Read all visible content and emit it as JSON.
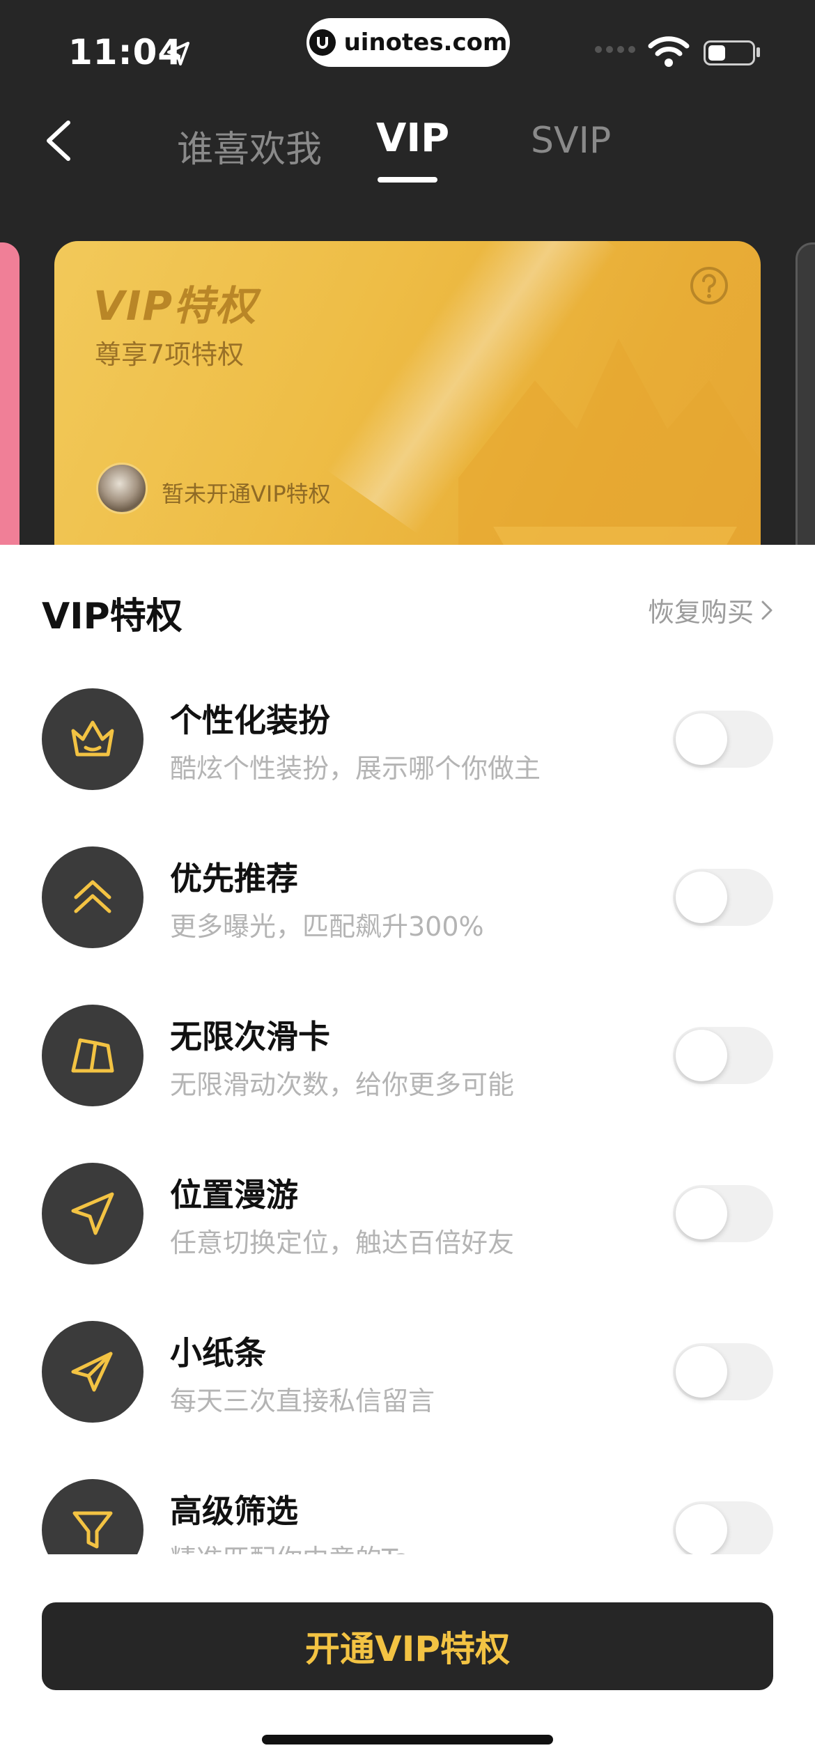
{
  "status_bar": {
    "time": "11:04",
    "watermark": "uinotes.com",
    "battery_level_pct": 40
  },
  "nav": {
    "tabs": [
      {
        "label": "谁喜欢我",
        "active": false
      },
      {
        "label": "VIP",
        "active": true
      },
      {
        "label": "SVIP",
        "active": false
      }
    ]
  },
  "card": {
    "title": "VIP特权",
    "subtitle": "尊享7项特权",
    "status": "暂未开通VIP特权"
  },
  "sheet": {
    "title": "VIP特权",
    "restore_label": "恢复购买",
    "items": [
      {
        "icon": "crown-icon",
        "name": "个性化装扮",
        "desc": "酷炫个性装扮，展示哪个你做主",
        "enabled": false
      },
      {
        "icon": "double-chevron-up-icon",
        "name": "优先推荐",
        "desc": "更多曝光，匹配飙升300%",
        "enabled": false
      },
      {
        "icon": "cards-icon",
        "name": "无限次滑卡",
        "desc": "无限滑动次数，给你更多可能",
        "enabled": false
      },
      {
        "icon": "location-arrow-icon",
        "name": "位置漫游",
        "desc": "任意切换定位，触达百倍好友",
        "enabled": false
      },
      {
        "icon": "paper-plane-icon",
        "name": "小纸条",
        "desc": "每天三次直接私信留言",
        "enabled": false
      },
      {
        "icon": "filter-icon",
        "name": "高级筛选",
        "desc": "精准匹配你中意的Ta",
        "enabled": false
      }
    ]
  },
  "cta": {
    "label": "开通VIP特权"
  },
  "colors": {
    "accent_gold": "#f3c343",
    "dark_bg": "#262626",
    "card_gold": "#eebd46"
  }
}
